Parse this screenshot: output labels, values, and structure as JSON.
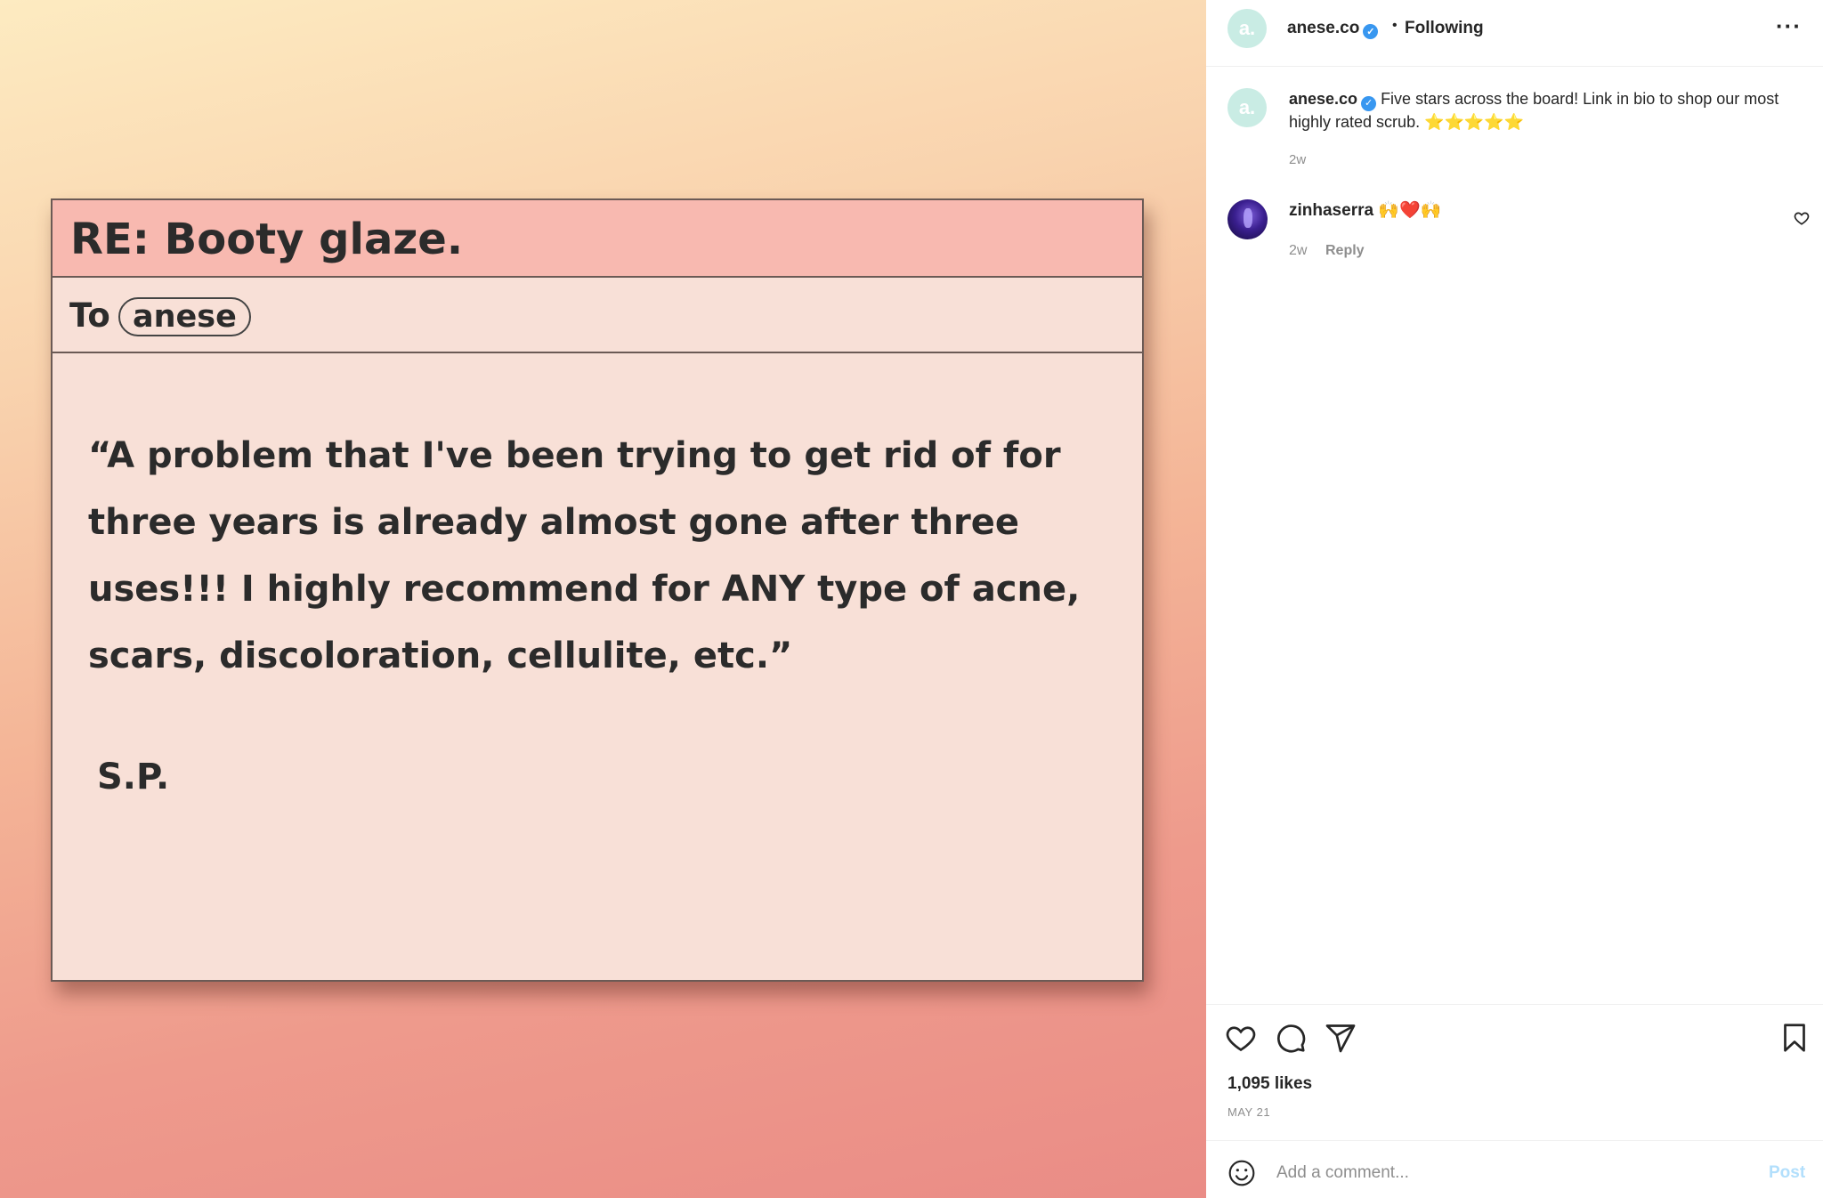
{
  "media": {
    "subject": "RE: Booty glaze.",
    "to_label": "To",
    "to_recipient": "anese",
    "quote": "“A problem that I've been trying to get rid of for three years is already almost gone after three uses!!! I highly recommend for ANY type of acne, scars, discoloration, cellulite, etc.”",
    "signature": "S.P."
  },
  "header": {
    "avatar_letter": "a.",
    "username": "anese.co",
    "separator": "•",
    "follow_status": "Following",
    "more_label": "···"
  },
  "caption": {
    "avatar_letter": "a.",
    "username": "anese.co",
    "text": "Five stars across the board! Link in bio to shop our most highly rated scrub. ⭐⭐⭐⭐⭐",
    "time": "2w"
  },
  "comment": {
    "username": "zinhaserra",
    "text": "🙌❤️🙌",
    "time": "2w",
    "reply_label": "Reply"
  },
  "stats": {
    "likes": "1,095 likes",
    "date": "MAY 21"
  },
  "composer": {
    "placeholder": "Add a comment...",
    "post_label": "Post"
  },
  "colors": {
    "verified": "#3897f0",
    "post_button_disabled": "#b2dffc",
    "note_subject_bg": "#f8b9b0",
    "note_bg": "#f8e0d7"
  }
}
